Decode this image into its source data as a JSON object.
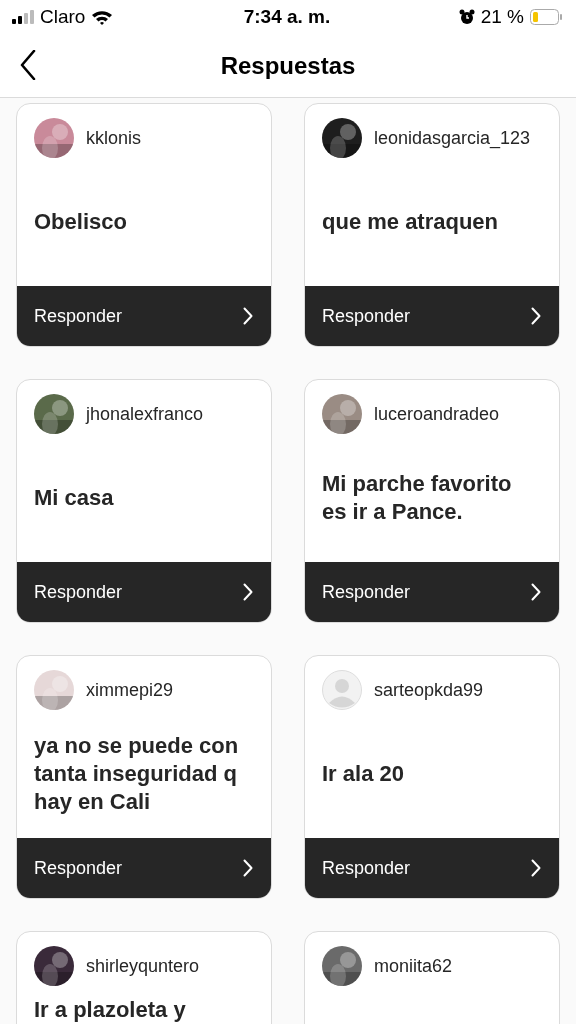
{
  "status_bar": {
    "carrier": "Claro",
    "time": "7:34 a. m.",
    "battery": "21 %"
  },
  "header": {
    "title": "Respuestas"
  },
  "responses": [
    {
      "username": "kklonis",
      "message": "Obelisco",
      "action": "Responder"
    },
    {
      "username": "leonidasgarcia_123",
      "message": "que me atraquen",
      "action": "Responder"
    },
    {
      "username": "jhonalexfranco",
      "message": "Mi casa",
      "action": "Responder"
    },
    {
      "username": "luceroandradeo",
      "message": "Mi parche favorito es ir a Pance.",
      "action": "Responder"
    },
    {
      "username": "ximmepi29",
      "message": "ya no se puede con tanta inseguridad q hay en Cali",
      "action": "Responder"
    },
    {
      "username": "sarteopkda99",
      "avatar": {
        "kind": "default"
      },
      "message": "Ir ala 20",
      "action": "Responder"
    },
    {
      "username": "shirleyquntero",
      "message": "Ir a plazoleta y"
    },
    {
      "username": "moniita62"
    }
  ]
}
